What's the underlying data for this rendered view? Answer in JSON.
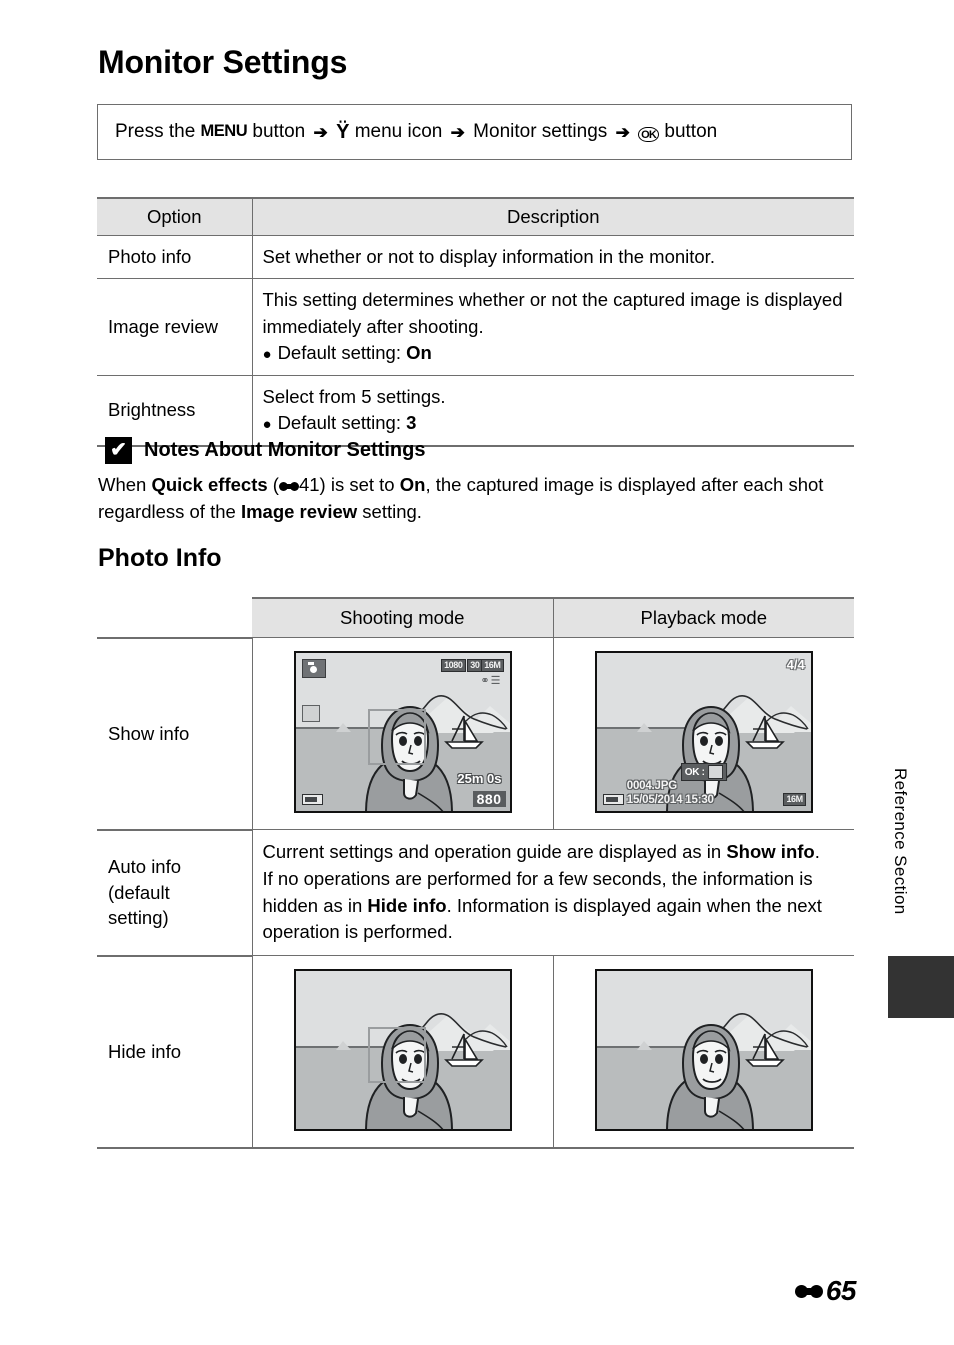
{
  "page": {
    "title": "Monitor Settings",
    "side_tab_label": "Reference Section",
    "page_number": "65",
    "page_prefix_icon": "reference-section-symbol"
  },
  "menu_path": {
    "press_the": "Press the",
    "menu_button_label": "MENU",
    "button_word": "button",
    "arrow": "➔",
    "wrench_icon": "Ÿ",
    "menu_icon_label": "menu icon",
    "target": "Monitor settings",
    "ok_icon_label": "OK",
    "ok_button_word": "button"
  },
  "options_table": {
    "headers": [
      "Option",
      "Description"
    ],
    "rows": [
      {
        "option": "Photo info",
        "description_lines": [
          "Set whether or not to display information in the monitor."
        ],
        "bullets": []
      },
      {
        "option": "Image review",
        "description_lines": [
          "This setting determines whether or not the captured image is",
          "displayed immediately after shooting."
        ],
        "bullets": [
          {
            "text": "Default setting: ",
            "bold": "On"
          }
        ]
      },
      {
        "option": "Brightness",
        "description_lines": [
          "Select from 5 settings."
        ],
        "bullets": [
          {
            "text": "Default setting: ",
            "bold": "3"
          }
        ]
      }
    ]
  },
  "note": {
    "icon": "caution-icon",
    "icon_glyph": "✔",
    "title": "Notes About Monitor Settings",
    "body_part1": "When ",
    "body_bold1": "Quick effects",
    "body_paren_open": " (",
    "body_ref": "41",
    "body_paren_close": ") is set to ",
    "body_bold2": "On",
    "body_part2": ", the captured image is displayed after each shot regardless of the ",
    "body_bold3": "Image review",
    "body_part3": " setting."
  },
  "photo_info": {
    "section_title": "Photo Info",
    "headers": [
      "",
      "Shooting mode",
      "Playback mode"
    ],
    "rows": [
      {
        "label": "Show info",
        "type": "images",
        "shooting": "lcd-show-info-shooting",
        "playback": "lcd-show-info-playback"
      },
      {
        "label_lines": [
          "Auto info",
          "(default",
          "setting)"
        ],
        "type": "text",
        "text_part1": "Current settings and operation guide are displayed as in ",
        "text_bold1": "Show info",
        "text_part2": ".",
        "text_part3": "If no operations are performed for a few seconds, the information is hidden as in ",
        "text_bold2": "Hide info",
        "text_part4": ". Information is displayed again when the next operation is performed."
      },
      {
        "label": "Hide info",
        "type": "images",
        "shooting": "lcd-hide-info-shooting",
        "playback": "lcd-hide-info-playback"
      }
    ]
  },
  "lcd_osd": {
    "shooting": {
      "mode_icon": "scene-auto-icon",
      "movie_quality": "1080",
      "frame_rate": "30",
      "image_size": "16M",
      "pen_icon": "quick-effects-icon",
      "battery_icon": "battery-icon",
      "recording_time": "25m 0s",
      "shots_remaining": "880"
    },
    "playback": {
      "frame_counter": "4/4",
      "filename": "0004.JPG",
      "datetime": "15/05/2014 15:30",
      "ok_guide_label": "OK :",
      "image_size": "16M",
      "battery_icon": "battery-icon"
    }
  },
  "colors": {
    "rule": "#6e6e6e",
    "header_fill": "#e3e3e3",
    "tab_dark": "#333333",
    "lcd_sky": "#dddfe0",
    "lcd_sea": "#b9bcbd",
    "lcd_person": "#9a9d9f"
  }
}
